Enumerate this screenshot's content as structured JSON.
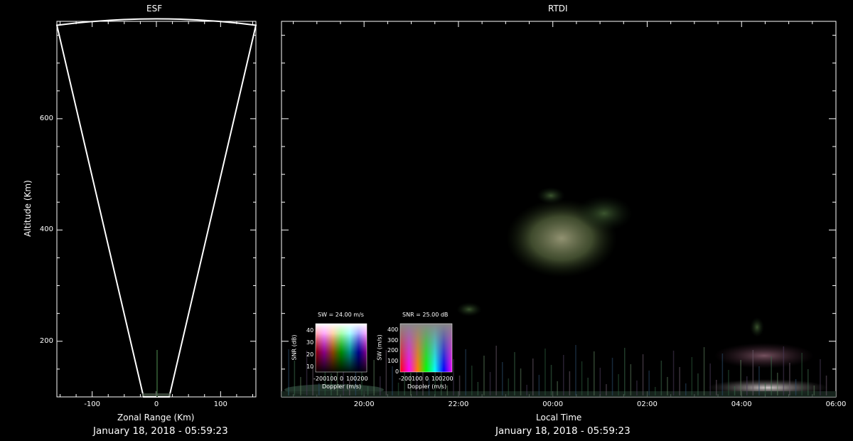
{
  "chart_data": [
    {
      "type": "scatter",
      "title": "ESF",
      "xlabel": "Zonal Range (Km)",
      "ylabel": "Altitude (Km)",
      "footer": "January 18, 2018 - 05:59:23",
      "xlim": [
        -155,
        155
      ],
      "ylim": [
        100,
        775
      ],
      "x_ticks": [
        -100,
        0,
        100
      ],
      "y_ticks": [
        200,
        400,
        600
      ],
      "coverage_fan": {
        "lower_left": [
          -20,
          100
        ],
        "lower_right": [
          20,
          100
        ],
        "upper_left": [
          -155,
          768
        ],
        "apex": [
          0,
          783
        ],
        "upper_right": [
          155,
          768
        ]
      }
    },
    {
      "type": "heatmap",
      "title": "RTDI",
      "xlabel": "Local Time",
      "footer": "January 18, 2018 - 05:59:23",
      "x_ticks": [
        "20:00",
        "22:00",
        "00:00",
        "02:00",
        "04:00",
        "06:00"
      ],
      "x_tick_hours": [
        20,
        22,
        24,
        26,
        28,
        30
      ],
      "xlim_hours": [
        18.25,
        30
      ],
      "ylim": [
        100,
        775
      ]
    }
  ],
  "legends": {
    "sw": {
      "title": "SW = 24.00 m/s",
      "ylabel": "SNR (dB)",
      "xlabel": "Doppler (m/s)",
      "y_ticks": [
        "40",
        "30",
        "20",
        "10"
      ],
      "x_ticks": [
        "-200100",
        "0",
        "100200"
      ]
    },
    "snr": {
      "title": "SNR = 25.00 dB",
      "ylabel": "SW (m/s)",
      "xlabel": "Doppler (m/s)",
      "y_ticks": [
        "400",
        "300",
        "200",
        "100",
        "0"
      ],
      "x_ticks": [
        "-200100",
        "0",
        "100200"
      ]
    }
  }
}
